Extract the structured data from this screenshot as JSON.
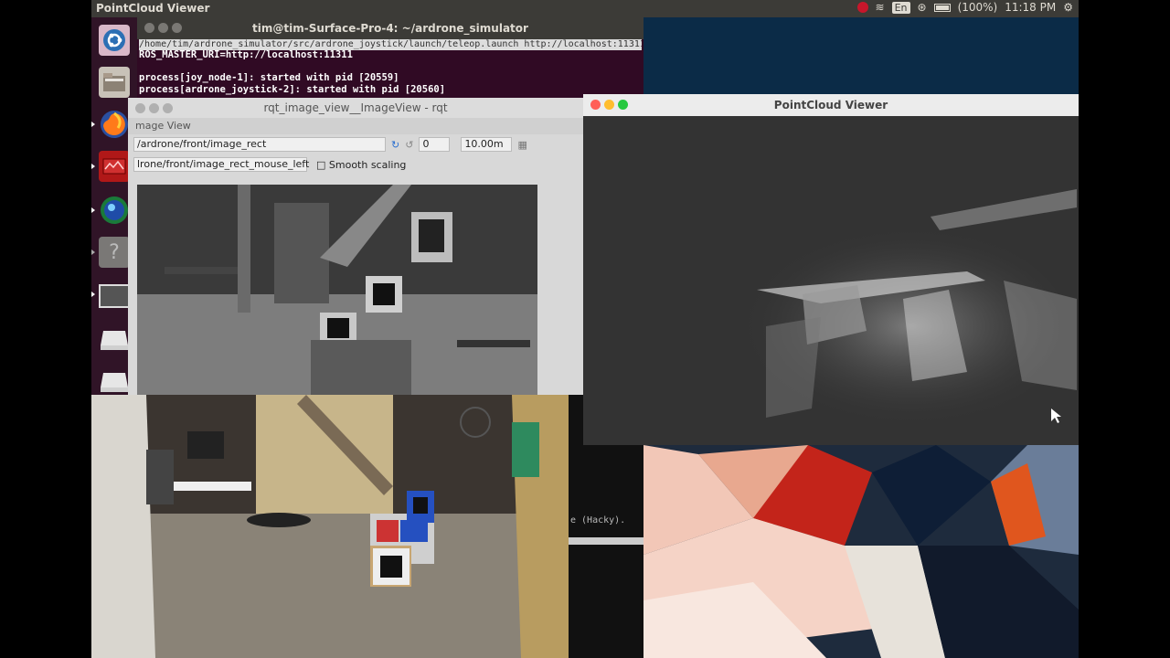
{
  "top_panel": {
    "app_name": "PointCloud Viewer",
    "keyboard_layout": "En",
    "battery": "(100%)",
    "clock": "11:18 PM",
    "icons": [
      "record-icon",
      "wifi-icon",
      "keyboard-icon",
      "bluetooth-icon",
      "battery-icon",
      "settings-gear-icon"
    ]
  },
  "launcher": {
    "items": [
      "ubuntu-dash-icon",
      "files-icon",
      "firefox-icon",
      "app-icon",
      "globe-icon",
      "help-icon",
      "workspace-icon",
      "drive-icon",
      "drive-icon-2"
    ]
  },
  "terminal": {
    "title": "tim@tim-Surface-Pro-4: ~/ardrone_simulator",
    "path_line": "/home/tim/ardrone_simulator/src/ardrone_joystick/launch/teleop.launch http://localhost:11311 87x13",
    "lines": [
      "ROS_MASTER_URI=http://localhost:11311",
      "",
      "process[joy_node-1]: started with pid [20559]",
      "process[ardrone_joystick-2]: started with pid [20560]"
    ]
  },
  "rqt": {
    "title": "rqt_image_view__ImageView - rqt",
    "subtitle": "mage View",
    "topic": "/ardrone/front/image_rect",
    "rotation": "0",
    "zoom": "10.00m",
    "mouse_topic": "lrone/front/image_rect_mouse_left",
    "smooth_scaling": "Smooth scaling"
  },
  "pointcloud": {
    "title": "PointCloud Viewer"
  },
  "term2": {
    "text": "e (Hacky)."
  }
}
